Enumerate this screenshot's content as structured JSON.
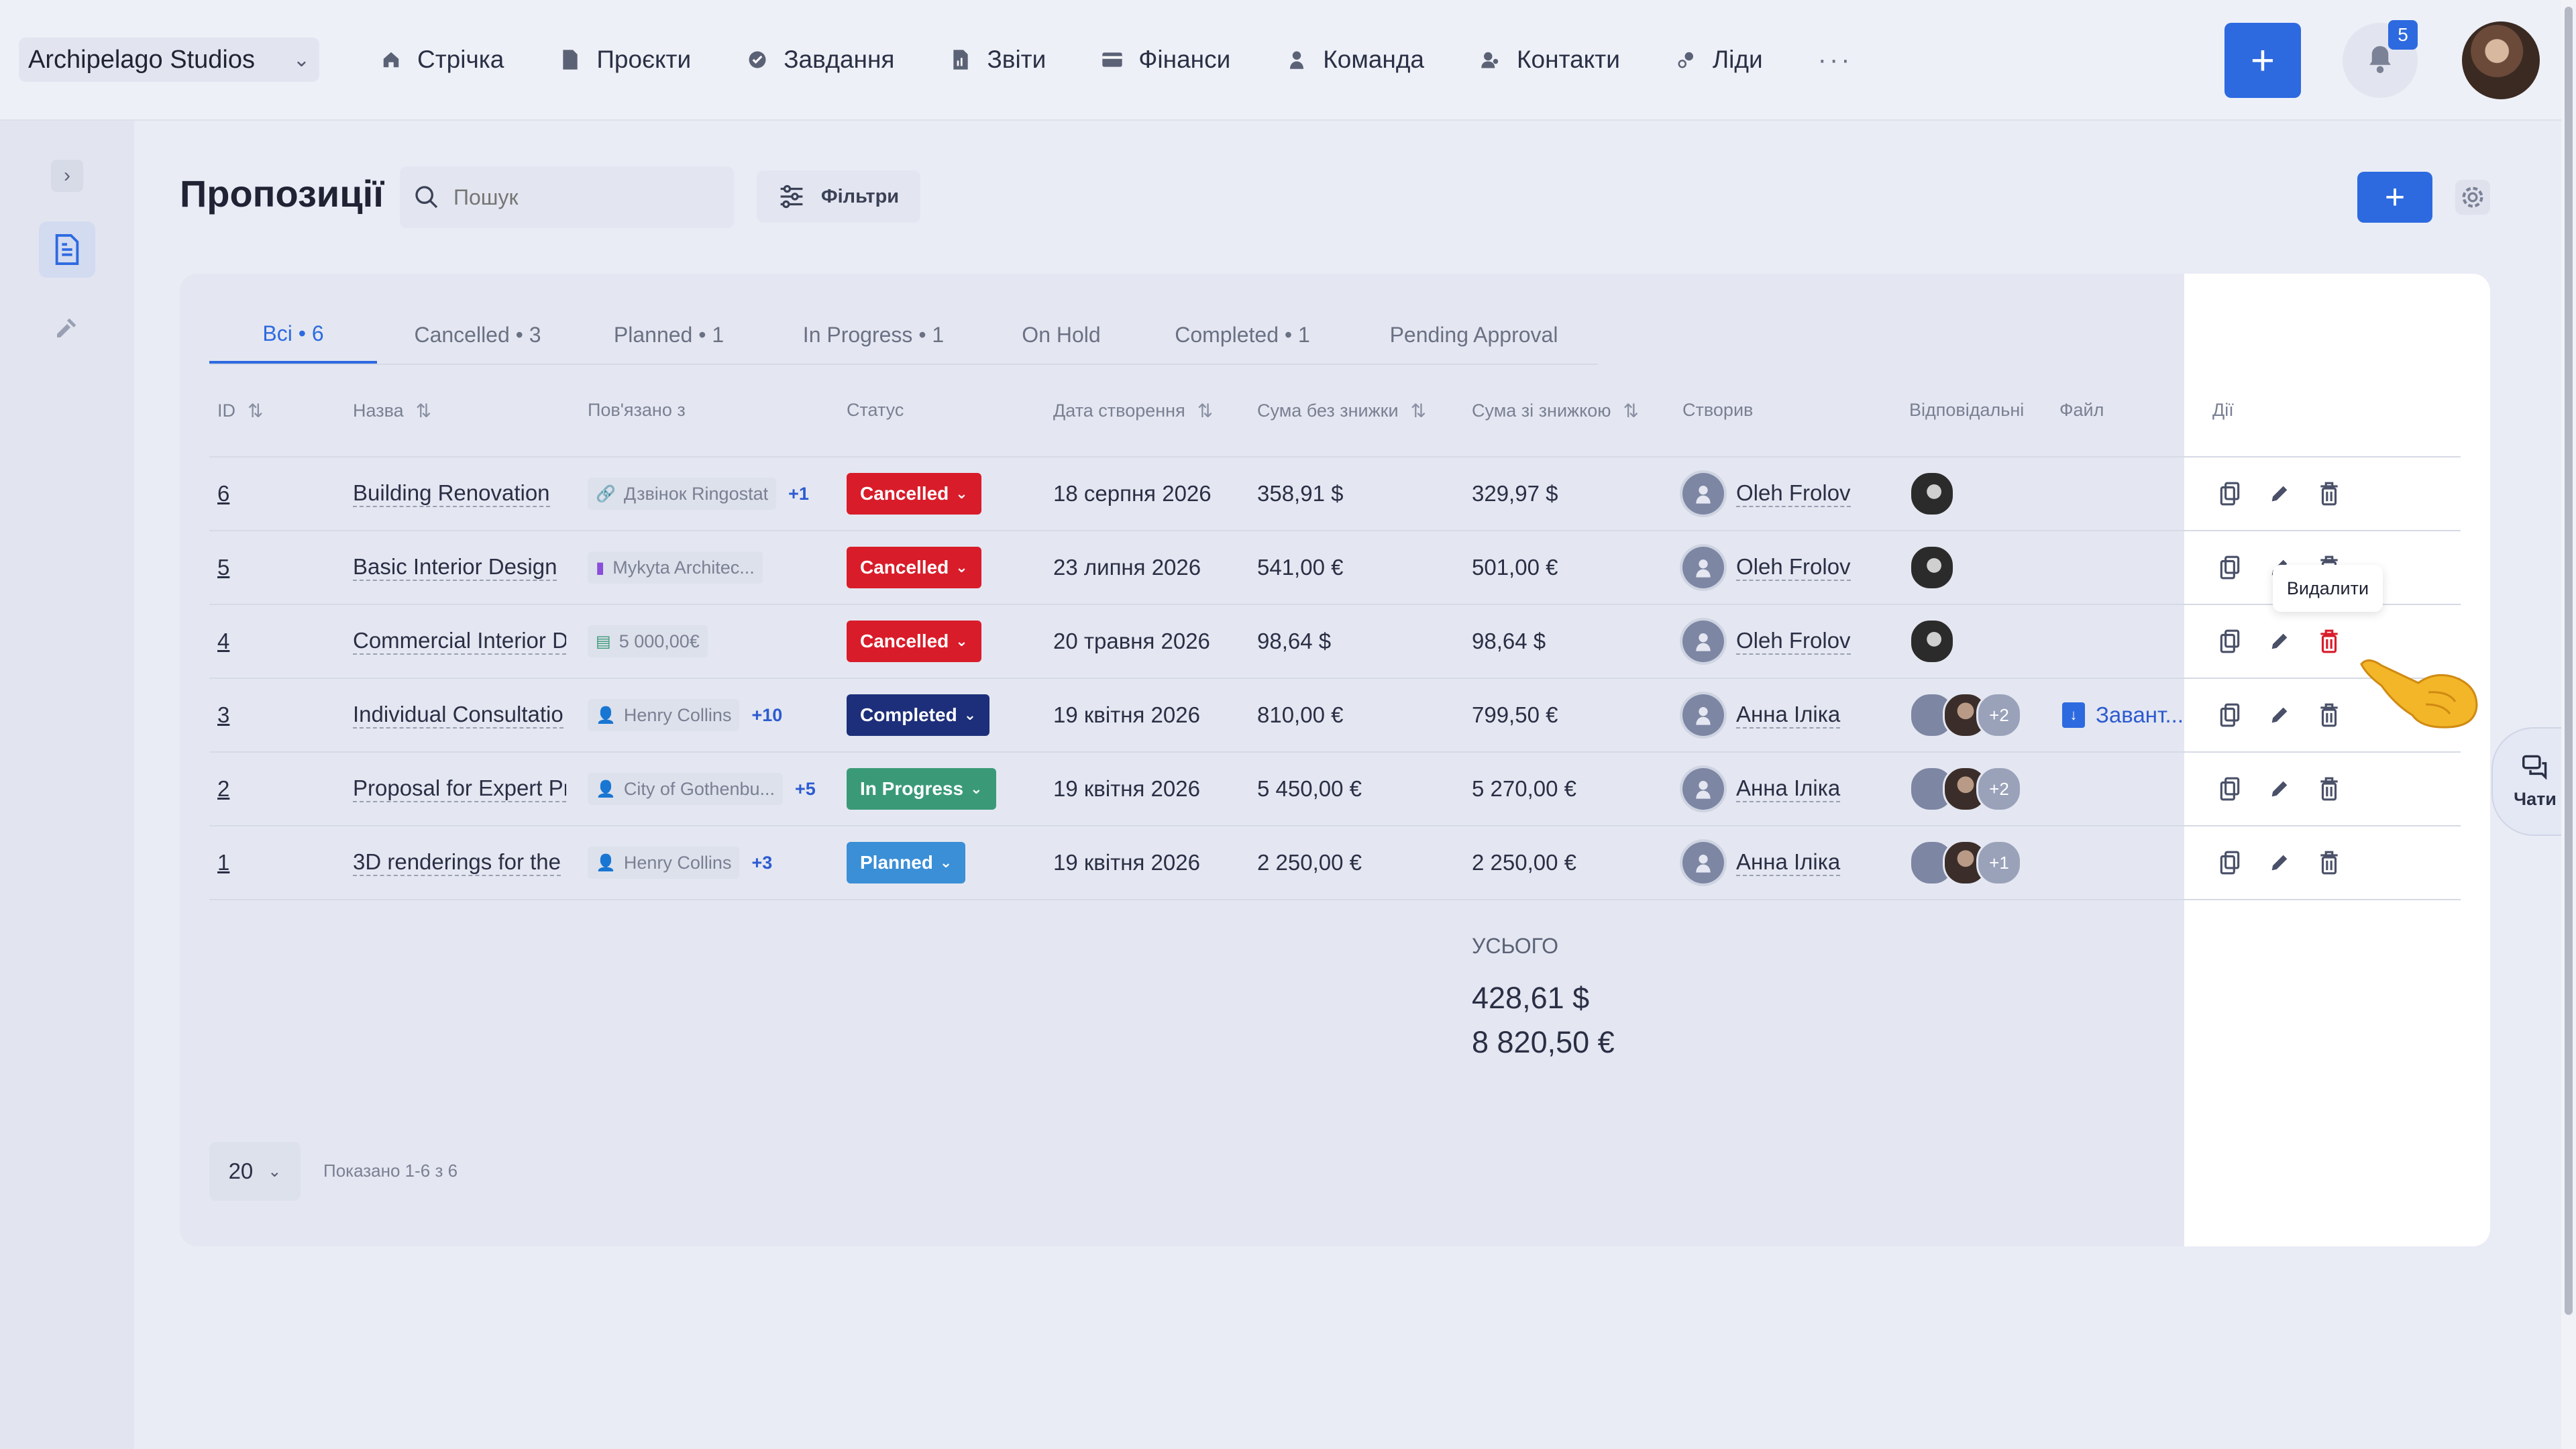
{
  "workspace": {
    "name": "Archipelago Studios"
  },
  "nav": [
    {
      "label": "Стрічка",
      "icon": "home-icon"
    },
    {
      "label": "Проєкти",
      "icon": "document-icon"
    },
    {
      "label": "Завдання",
      "icon": "check-circle-icon"
    },
    {
      "label": "Звіти",
      "icon": "report-icon"
    },
    {
      "label": "Фінанси",
      "icon": "wallet-icon"
    },
    {
      "label": "Команда",
      "icon": "person-icon"
    },
    {
      "label": "Контакти",
      "icon": "contacts-icon"
    },
    {
      "label": "Ліди",
      "icon": "leads-icon"
    }
  ],
  "nav_more": "···",
  "notifications": {
    "count": "5"
  },
  "page": {
    "title": "Пропозиції",
    "search_placeholder": "Пошук",
    "filters_label": "Фільтри",
    "add_label": "+"
  },
  "tabs": [
    {
      "label": "Всі • 6",
      "active": true
    },
    {
      "label": "Cancelled • 3"
    },
    {
      "label": "Planned • 1"
    },
    {
      "label": "In Progress • 1"
    },
    {
      "label": "On Hold"
    },
    {
      "label": "Completed • 1"
    },
    {
      "label": "Pending Approval"
    }
  ],
  "columns": {
    "id": "ID",
    "name": "Назва",
    "linked": "Пов'язано з",
    "status": "Статус",
    "created": "Дата створення",
    "sum_no_discount": "Сума без знижки",
    "sum_discount": "Сума зі знижкою",
    "creator": "Створив",
    "responsible": "Відповідальні",
    "file": "Файл",
    "actions": "Дії"
  },
  "rows": [
    {
      "id": "6",
      "name": "Building Renovation",
      "linked": "Дзвінок Ringostat",
      "linked_more": "+1",
      "status": "Cancelled",
      "created": "18 серпня 2026",
      "sum": "358,91 $",
      "sum_discount": "329,97 $",
      "creator": "Oleh Frolov",
      "resp_more": "",
      "file": ""
    },
    {
      "id": "5",
      "name": "Basic Interior Design",
      "linked": "Mykyta Architec...",
      "linked_more": "",
      "status": "Cancelled",
      "created": "23 липня 2026",
      "sum": "541,00 €",
      "sum_discount": "501,00 €",
      "creator": "Oleh Frolov",
      "resp_more": "",
      "file": ""
    },
    {
      "id": "4",
      "name": "Commercial Interior D",
      "linked": "5 000,00€",
      "linked_more": "",
      "status": "Cancelled",
      "created": "20 травня 2026",
      "sum": "98,64 $",
      "sum_discount": "98,64 $",
      "creator": "Oleh Frolov",
      "resp_more": "",
      "file": ""
    },
    {
      "id": "3",
      "name": "Individual Consultatio",
      "linked": "Henry Collins",
      "linked_more": "+10",
      "status": "Completed",
      "created": "19 квітня 2026",
      "sum": "810,00 €",
      "sum_discount": "799,50 €",
      "creator": "Анна Іліка",
      "resp_more": "+2",
      "file": "Завант..."
    },
    {
      "id": "2",
      "name": "Proposal for Expert Pr",
      "linked": "City of Gothenbu...",
      "linked_more": "+5",
      "status": "In Progress",
      "created": "19 квітня 2026",
      "sum": "5 450,00 €",
      "sum_discount": "5 270,00 €",
      "creator": "Анна Іліка",
      "resp_more": "+2",
      "file": ""
    },
    {
      "id": "1",
      "name": "3D renderings for the",
      "linked": "Henry Collins",
      "linked_more": "+3",
      "status": "Planned",
      "created": "19 квітня 2026",
      "sum": "2 250,00 €",
      "sum_discount": "2 250,00 €",
      "creator": "Анна Іліка",
      "resp_more": "+1",
      "file": ""
    }
  ],
  "status_colors": {
    "Cancelled": "#d91c2a",
    "Completed": "#1d2f7a",
    "In Progress": "#3a9a78",
    "Planned": "#3b8fd6"
  },
  "tooltip": "Видалити",
  "totals": {
    "label": "УСЬОГО",
    "usd": "428,61 $",
    "eur": "8 820,50 €"
  },
  "pagination": {
    "per_page": "20",
    "shown": "Показано 1-6 з 6"
  },
  "chat": {
    "label": "Чати"
  }
}
